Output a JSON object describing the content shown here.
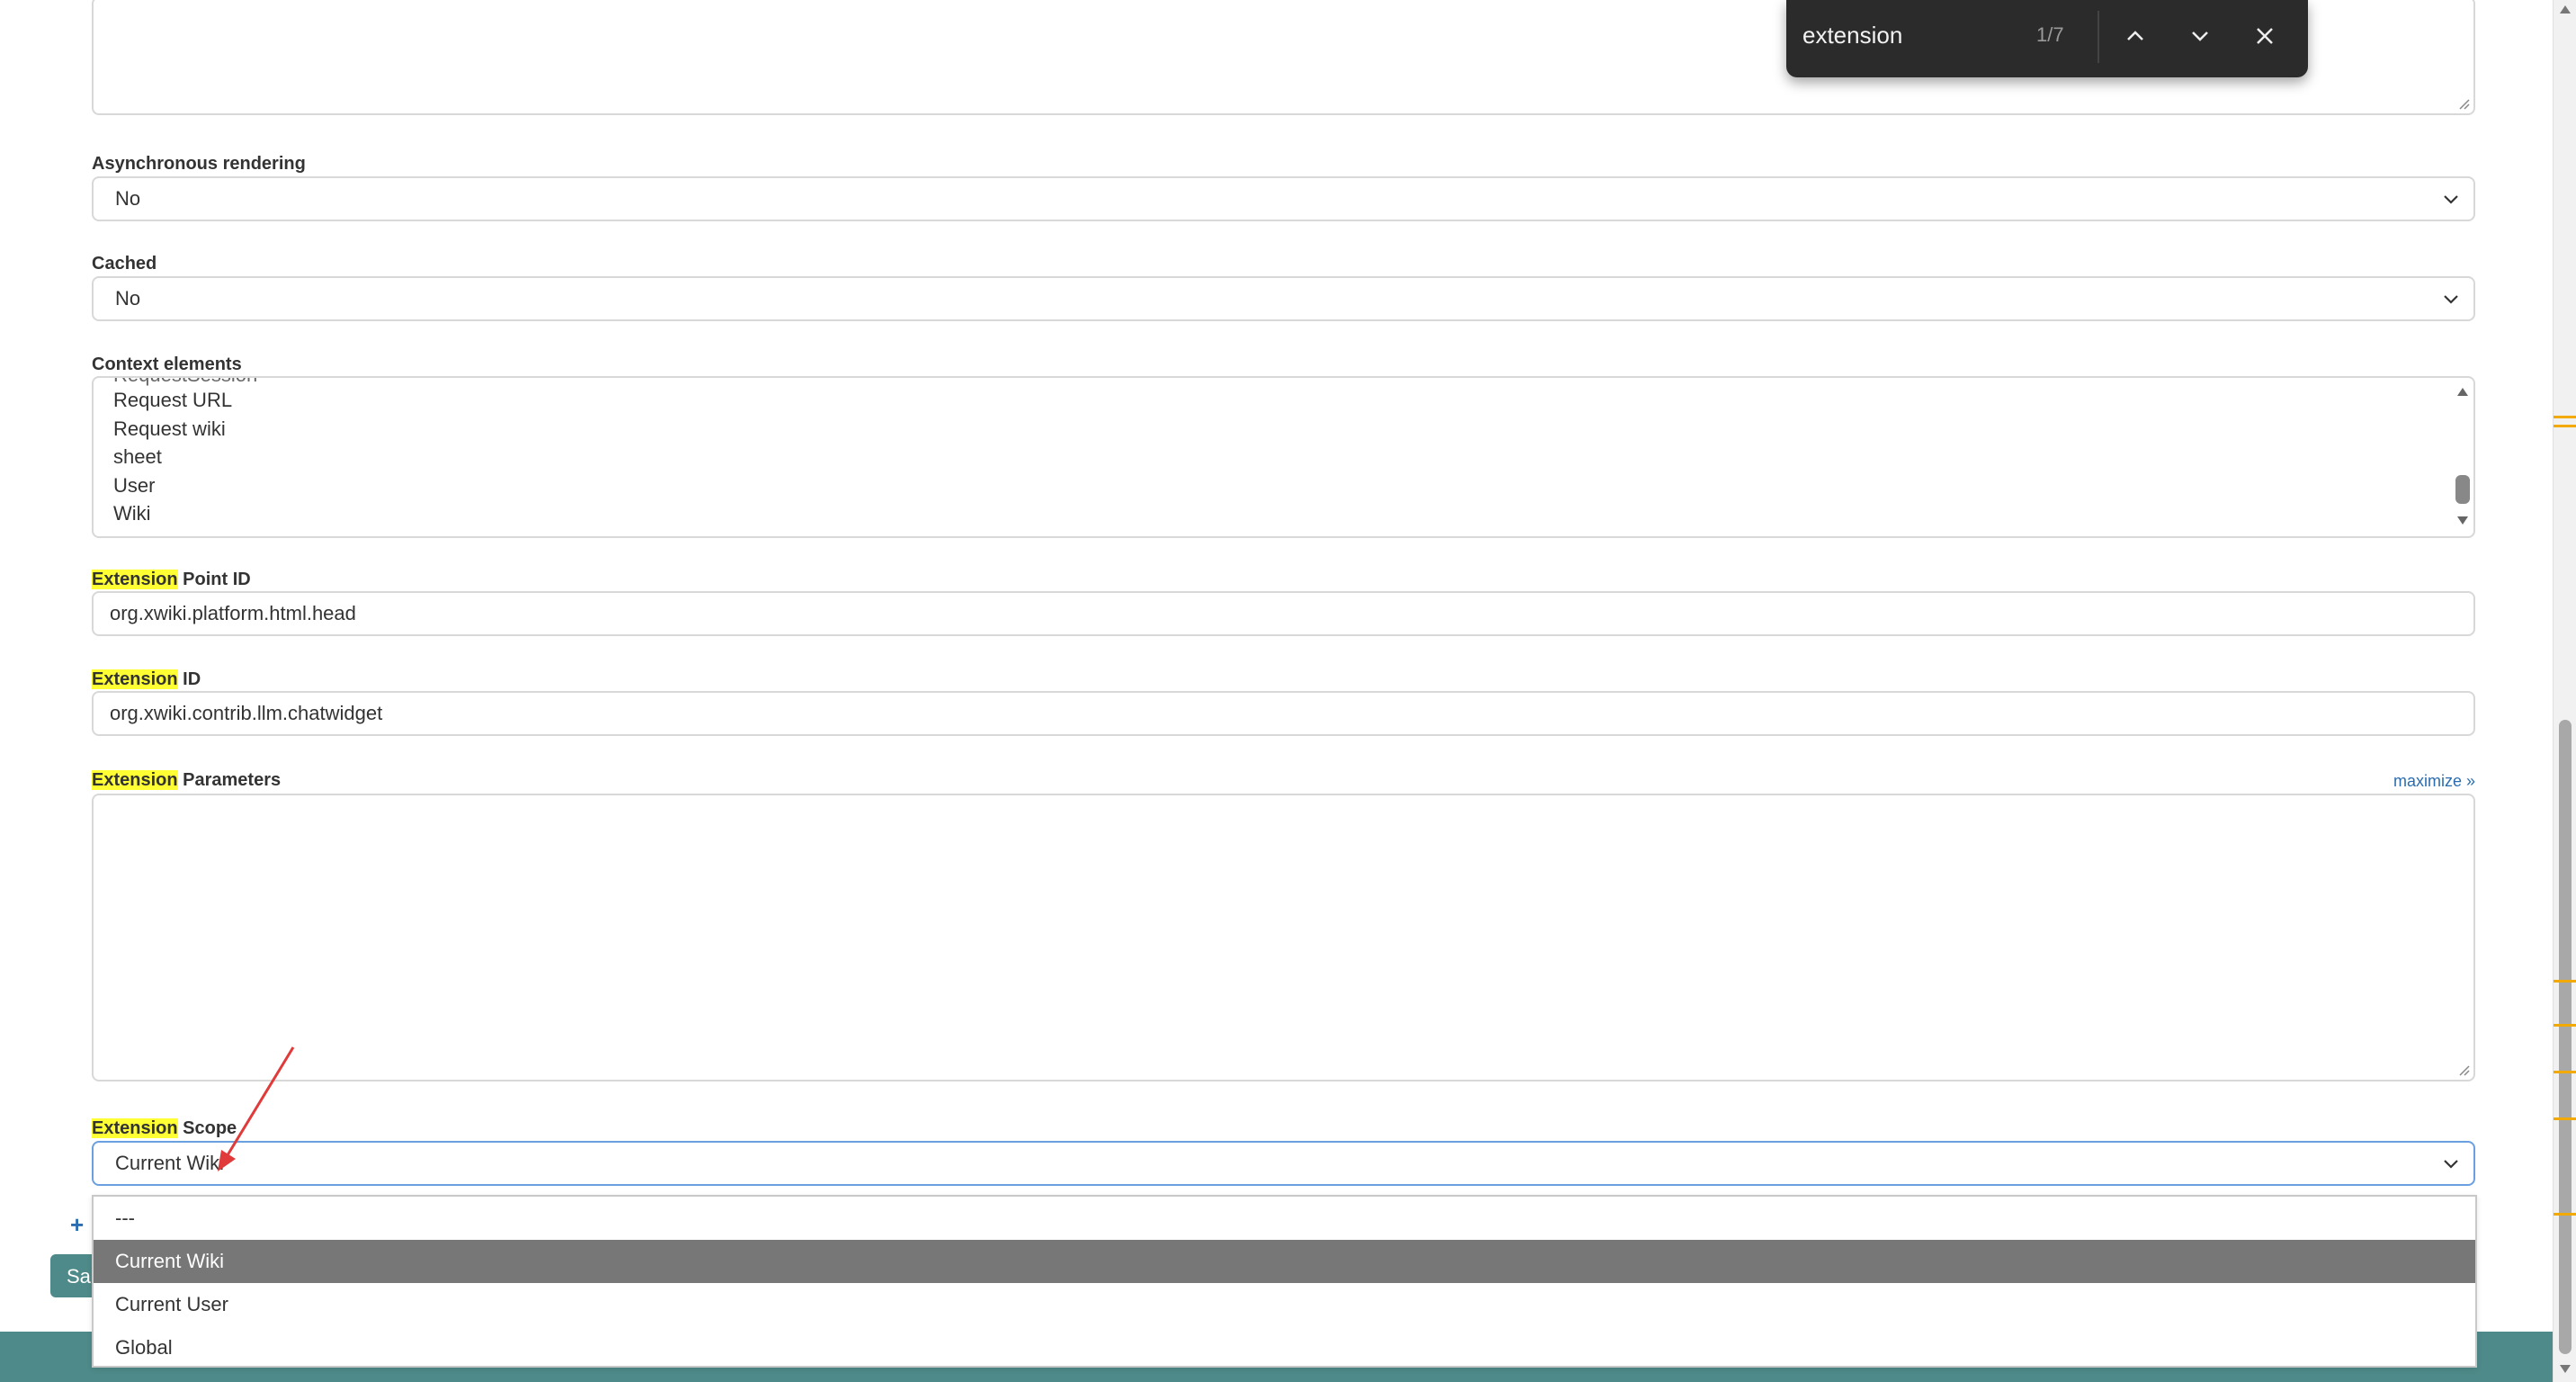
{
  "form": {
    "async_label": "Asynchronous rendering",
    "async_value": "No",
    "cached_label": "Cached",
    "cached_value": "No",
    "context_label": "Context elements",
    "context_items": [
      "Request URL",
      "Request wiki",
      "sheet",
      "User",
      "Wiki"
    ],
    "ext_point_label_hl": "Extension",
    "ext_point_label_rest": "Point ID",
    "ext_point_value": "org.xwiki.platform.html.head",
    "ext_id_label_hl": "Extension",
    "ext_id_label_rest": "ID",
    "ext_id_value": "org.xwiki.contrib.llm.chatwidget",
    "ext_params_label_hl": "Extension",
    "ext_params_label_rest": "Parameters",
    "maximize_link": "maximize »",
    "ext_scope_label_hl": "Extension",
    "ext_scope_label_rest": "Scope",
    "ext_scope_value": "Current Wiki",
    "scope_options": [
      "---",
      "Current Wiki",
      "Current User",
      "Global"
    ],
    "save_partial": "Sa",
    "add_icon": "+"
  },
  "find_bar": {
    "query": "extension",
    "count": "1/7"
  },
  "icons": {
    "select_chevron": "chevron-down-icon",
    "find_prev": "chevron-up-icon",
    "find_next": "chevron-down-icon",
    "find_close": "close-icon"
  },
  "colors": {
    "highlight": "#ffff33",
    "footer": "#4e8a89",
    "selected_option": "#777777",
    "annotation_arrow": "#e03a3a"
  }
}
